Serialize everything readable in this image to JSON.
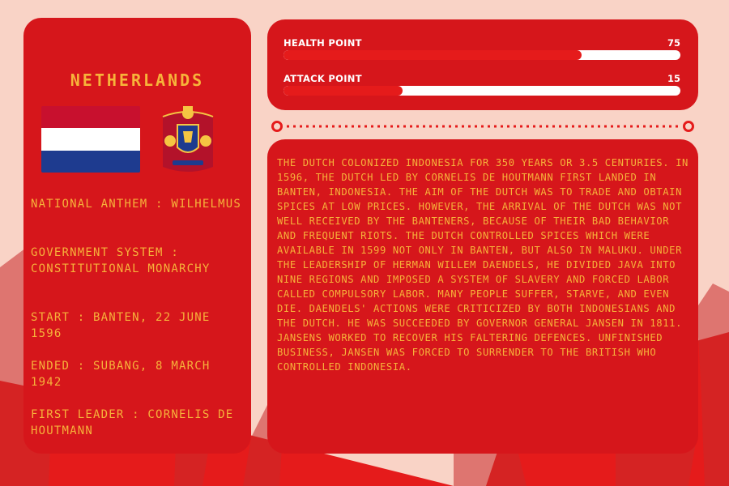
{
  "country": {
    "name": "NETHERLANDS",
    "flag_icon": "netherlands-flag-icon",
    "coat_icon": "coat-of-arms-icon"
  },
  "info": {
    "anthem": "National Anthem : Wilhelmus",
    "government": "Government System : Constitutional Monarchy",
    "start": "Start : Banten, 22 June 1596",
    "ended": "Ended : Subang, 8 March 1942",
    "leader": "First Leader : Cornelis de Houtmann"
  },
  "stats": {
    "health": {
      "label": "HEALTH POINT",
      "value": "75",
      "fraction": 0.75
    },
    "attack": {
      "label": "ATTACK POINT",
      "value": "15",
      "fraction": 0.3
    }
  },
  "description": "The Dutch colonized Indonesia for 350 years or 3.5 centuries. In 1596, the Dutch led by Cornelis de Houtmann first landed in Banten, Indonesia. The aim of the Dutch was to trade and obtain spices at low prices. However, the arrival of the Dutch was not well received by the Banteners, because of their bad behavior and frequent riots. The Dutch controlled spices which were available in 1599 not only in Banten, but also in Maluku. Under the leadership of Herman Willem Daendels, he divided Java into nine regions and imposed a system of slavery and forced labor called compulsory labor. Many people suffer, starve, and even die. Daendels' actions were criticized by both Indonesians and the Dutch. He was succeeded by Governor General Jansen in 1811. Jansens worked to recover his faltering defences. Unfinished business, Jansen was forced to surrender to the British who controlled Indonesia.",
  "colors": {
    "background": "#f9d3c6",
    "card": "#d6161b",
    "accent": "#e51b1b",
    "text": "#f6b23a"
  }
}
